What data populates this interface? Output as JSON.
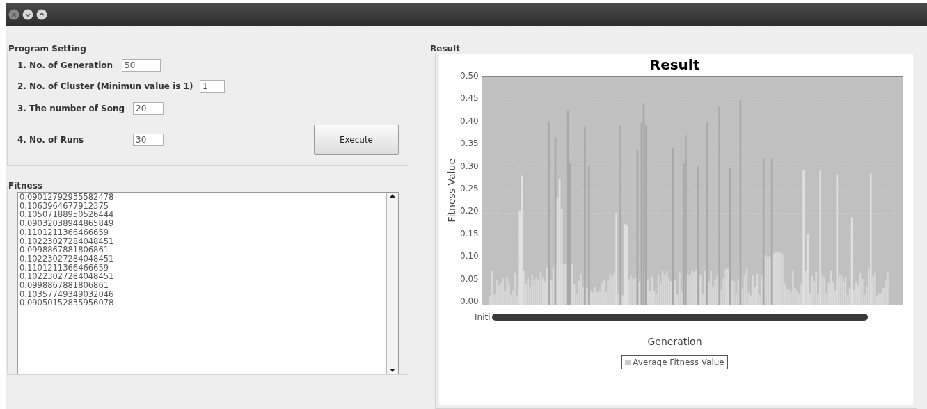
{
  "program_setting": {
    "title": "Program Setting",
    "fields": [
      {
        "label": "1. No. of Generation",
        "value": "50"
      },
      {
        "label": "2. No. of Cluster (Minimun value is 1)",
        "value": "1"
      },
      {
        "label": "3. The number of Song",
        "value": "20"
      },
      {
        "label": "4. No. of Runs",
        "value": "30"
      }
    ],
    "execute_button": "Execute"
  },
  "fitness": {
    "title": "Fitness",
    "lines": [
      "0.09012792935582478",
      "0.1063964677912375",
      "0.10507188950526444",
      "0.09032038944865849",
      "0.1101211366466659",
      "0.10223027284048451",
      "0.0998867881806861",
      "0.10223027284048451",
      "0.1101211366466659",
      "0.10223027284048451",
      "0.0998867881806861",
      "0.10357749349032046",
      "0.09050152835956078"
    ]
  },
  "result": {
    "title": "Result",
    "chart": {
      "title": "Result",
      "ylabel": "Fitness Value",
      "xlabel": "Generation",
      "yticks": [
        "0.50",
        "0.45",
        "0.40",
        "0.35",
        "0.30",
        "0.25",
        "0.20",
        "0.15",
        "0.10",
        "0.05",
        "0.00"
      ],
      "first_category": "Initi",
      "legend": "Average Fitness Value"
    }
  }
}
